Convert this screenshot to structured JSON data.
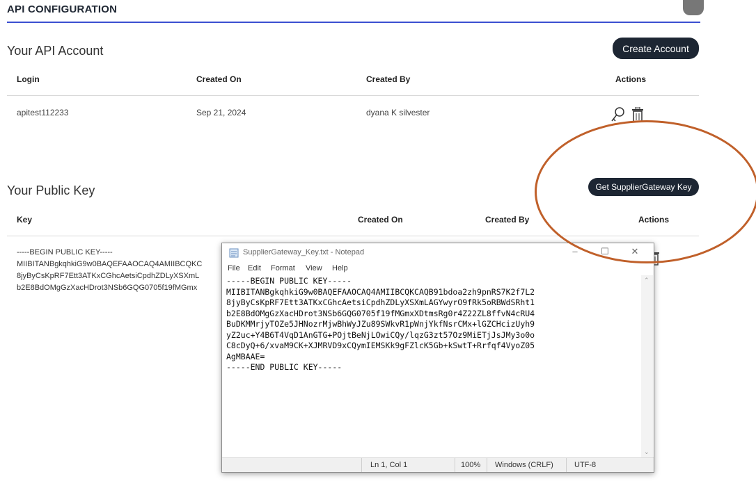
{
  "header": {
    "section_title": "API CONFIGURATION"
  },
  "api_account": {
    "heading": "Your API Account",
    "create_button": "Create Account",
    "columns": [
      "Login",
      "Created On",
      "Created By",
      "Actions"
    ],
    "rows": [
      {
        "login": "apitest112233",
        "created_on": "Sep 21, 2024",
        "created_by": "dyana K silvester",
        "actions": [
          "key-icon",
          "trash-icon"
        ]
      }
    ]
  },
  "public_key": {
    "heading": "Your Public Key",
    "get_key_button": "Get SupplierGateway Key",
    "columns": [
      "Key",
      "Created On",
      "Created By",
      "Actions"
    ],
    "key_preview_lines": [
      "-----BEGIN PUBLIC KEY-----",
      "MIIBITANBgkqhkiG9w0BAQEFAAOCAQ4AMIIBCQKC",
      "8jyByCsKpRF7Ett3ATKxCGhcAetsiCpdhZDLyXSXmL",
      "b2E8BdOMgGzXacHDrot3NSb6GQG0705f19fMGmx"
    ],
    "row_actions": [
      "trash-icon"
    ]
  },
  "notepad": {
    "title": "SupplierGateway_Key.txt - Notepad",
    "menu": [
      "File",
      "Edit",
      "Format",
      "View",
      "Help"
    ],
    "content": "-----BEGIN PUBLIC KEY-----\nMIIBITANBgkqhkiG9w0BAQEFAAOCAQ4AMIIBCQKCAQB91bdoa2zh9pnRS7K2f7L2\n8jyByCsKpRF7Ett3ATKxCGhcAetsiCpdhZDLyXSXmLAGYwyrO9fRk5oRBWdSRht1\nb2E8BdOMgGzXacHDrot3NSb6GQG0705f19fMGmxXDtmsRg0r4Z22ZL8ffvN4cRU4\nBuDKMMrjyTOZe5JHNozrMjwBhWyJZu89SWkvR1pWnjYkfNsrCMx+lGZCHcizUyh9\nyZ2uc+Y4B6T4VqD1AnGTG+POjtBeNjLOwiCQy/lqzG3zt57Oz9MiETjJsJMy3o0o\nC8cDyQ+6/xvaM9CK+XJMRVD9xCQymIEMSKk9gFZlcK5Gb+kSwtT+Rrfqf4VyoZ05\nAgMBAAE=\n-----END PUBLIC KEY-----",
    "status": {
      "position": "Ln 1, Col 1",
      "zoom": "100%",
      "line_ending": "Windows (CRLF)",
      "encoding": "UTF-8"
    },
    "window_controls": [
      "minimize-icon",
      "maximize-icon",
      "close-icon"
    ]
  },
  "colors": {
    "accent_rule": "#3b4fd1",
    "button_dark": "#1d2633",
    "highlight": "#c0602a"
  }
}
